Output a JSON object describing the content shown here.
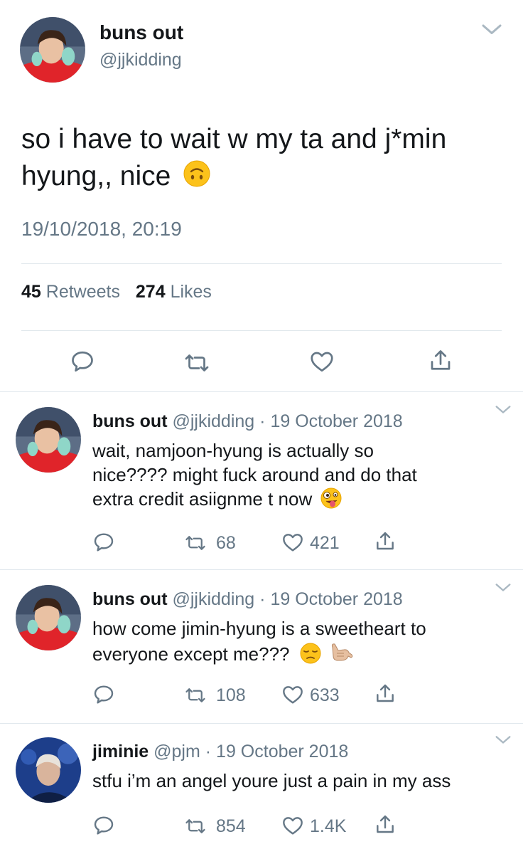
{
  "main_tweet": {
    "display_name": "buns out",
    "handle": "@jjkidding",
    "text_line1": "so i have to wait w my ta and j*min",
    "text_line2": "hyung,, nice",
    "text_emoji": "upside-down-face",
    "timestamp": "19/10/2018, 20:19",
    "retweets_count": "45",
    "retweets_label": "Retweets",
    "likes_count": "274",
    "likes_label": "Likes"
  },
  "replies": [
    {
      "display_name": "buns out",
      "handle": "@jjkidding",
      "separator": "·",
      "date": "19 October 2018",
      "line1": "wait, namjoon-hyung is actually so",
      "line2": "nice???? might fuck around and do that",
      "line3": "extra credit asiignme t now",
      "emoji": "zany-face",
      "retweets": "68",
      "likes": "421"
    },
    {
      "display_name": "buns out",
      "handle": "@jjkidding",
      "separator": "·",
      "date": "19 October 2018",
      "line1": "how come jimin-hyung is a sweetheart to",
      "line2": "everyone except me???",
      "emoji": "pensive-face, call-me-hand",
      "retweets": "108",
      "likes": "633"
    },
    {
      "display_name": "jiminie",
      "handle": "@pjm",
      "separator": "·",
      "date": "19 October 2018",
      "line1": "stfu i’m an angel youre just a pain in my ass",
      "retweets": "854",
      "likes": "1.4K"
    }
  ],
  "colors": {
    "text": "#14171a",
    "muted": "#657786",
    "divider": "#e1e8ed",
    "avatar_shirt": "#e0242a"
  }
}
